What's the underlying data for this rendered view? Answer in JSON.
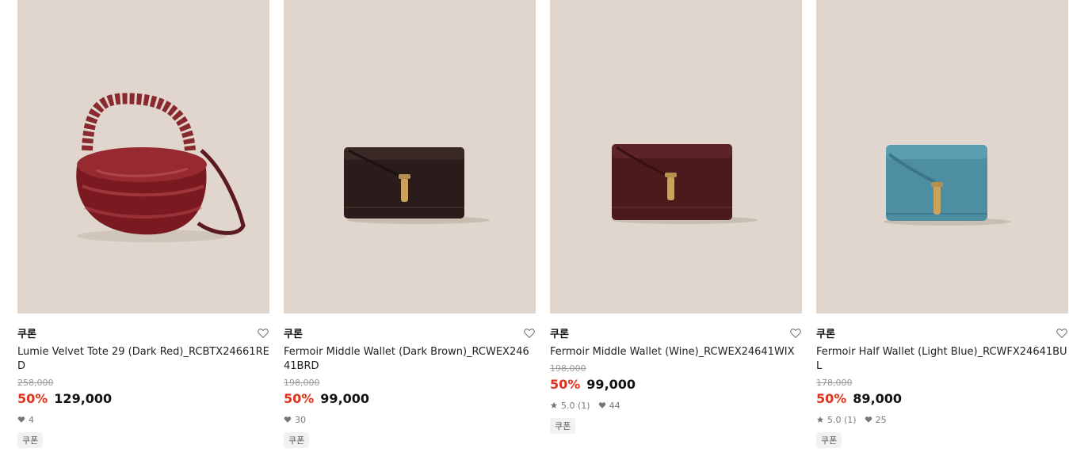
{
  "products": [
    {
      "brand": "쿠론",
      "name": "Lumie Velvet Tote 29 (Dark Red)_RCBTX24661RED",
      "original_price": "258,000",
      "discount": "50%",
      "price": "129,000",
      "rating": "",
      "likes": "4",
      "badge": "쿠폰",
      "color": "#7a1a20",
      "icon": "velvet-tote-image"
    },
    {
      "brand": "쿠론",
      "name": "Fermoir Middle Wallet (Dark Brown)_RCWEX24641BRD",
      "original_price": "198,000",
      "discount": "50%",
      "price": "99,000",
      "rating": "",
      "likes": "30",
      "badge": "쿠폰",
      "color": "#2a1c1a",
      "icon": "wallet-image"
    },
    {
      "brand": "쿠론",
      "name": "Fermoir Middle Wallet (Wine)_RCWEX24641WIX",
      "original_price": "198,000",
      "discount": "50%",
      "price": "99,000",
      "rating": "5.0 (1)",
      "likes": "44",
      "badge": "쿠폰",
      "color": "#4b1a1c",
      "icon": "wallet-image"
    },
    {
      "brand": "쿠론",
      "name": "Fermoir Half Wallet (Light Blue)_RCWFX24641BUL",
      "original_price": "178,000",
      "discount": "50%",
      "price": "89,000",
      "rating": "5.0 (1)",
      "likes": "25",
      "badge": "쿠폰",
      "color": "#4e8ea3",
      "icon": "half-wallet-image"
    }
  ],
  "colors": {
    "background_image": "#e0d6cd",
    "discount": "#e0311b",
    "hardware": "#c9a35e"
  }
}
